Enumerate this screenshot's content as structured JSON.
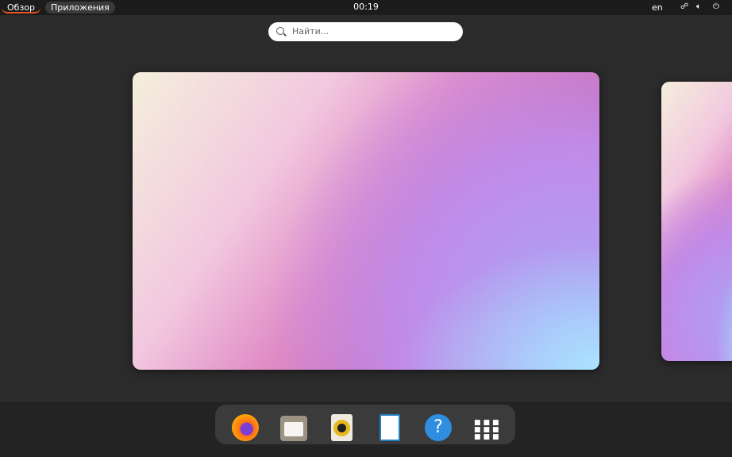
{
  "topbar": {
    "overview": "Обзор",
    "apps": "Приложения",
    "clock": "00:19",
    "lang": "en"
  },
  "search": {
    "placeholder": "Найти..."
  },
  "dock": [
    "Firefox",
    "Files",
    "Rhythmbox",
    "LibreOffice Writer",
    "Help",
    "Show Applications"
  ]
}
